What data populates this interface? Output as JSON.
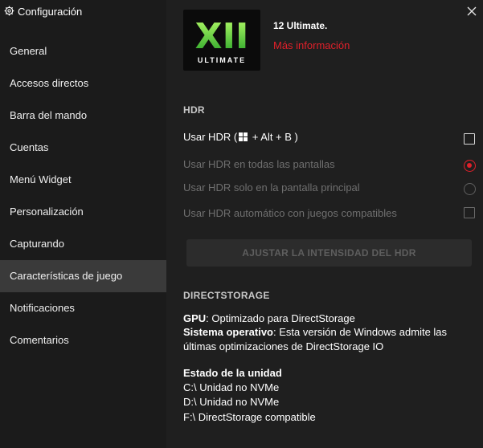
{
  "window": {
    "title": "Configuración",
    "close_glyph": "×"
  },
  "sidebar": {
    "items": [
      {
        "label": "General"
      },
      {
        "label": "Accesos directos"
      },
      {
        "label": "Barra del mando"
      },
      {
        "label": "Cuentas"
      },
      {
        "label": "Menú Widget"
      },
      {
        "label": "Personalización"
      },
      {
        "label": "Capturando"
      },
      {
        "label": "Características de juego",
        "active": true
      },
      {
        "label": "Notificaciones"
      },
      {
        "label": "Comentarios"
      }
    ]
  },
  "edition": {
    "logo_text": "XII",
    "logo_subtitle": "ULTIMATE",
    "text": "12 Ultimate.",
    "more_info": "Más información"
  },
  "hdr": {
    "section_title": "HDR",
    "use_hdr_prefix": "Usar HDR (",
    "use_hdr_suffix": " + Alt + B )",
    "all_screens": "Usar HDR en todas las pantallas",
    "main_screen": "Usar HDR solo en la pantalla principal",
    "auto_hdr": "Usar HDR automático con juegos compatibles",
    "adjust_button": "AJUSTAR LA INTENSIDAD DEL HDR"
  },
  "directstorage": {
    "section_title": "DIRECTSTORAGE",
    "gpu_label": "GPU",
    "gpu_value": ": Optimizado para DirectStorage",
    "os_label": "Sistema operativo",
    "os_value_line1": ": Esta versión de Windows admite las",
    "os_value_line2": "últimas optimizaciones de DirectStorage IO",
    "drive_status_title": "Estado de la unidad",
    "drives": [
      "C:\\ Unidad no NVMe",
      "D:\\ Unidad no NVMe",
      "F:\\ DirectStorage compatible"
    ]
  },
  "colors": {
    "accent": "#e0202a",
    "logo_green": "#3dd13a"
  },
  "icons": {
    "title": "gear-icon",
    "close": "close-icon",
    "windows_key": "windows-logo-icon"
  }
}
